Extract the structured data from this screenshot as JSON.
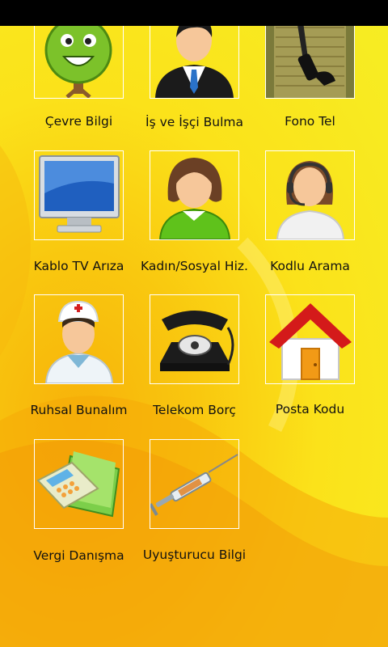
{
  "tiles": [
    {
      "label": "Çevre Bilgi",
      "icon": "tree-smiley-icon"
    },
    {
      "label": "İş ve İşçi Bulma",
      "icon": "businessman-icon"
    },
    {
      "label": "Fono Tel",
      "icon": "phone-handset-icon"
    },
    {
      "label": "Kablo TV Arıza",
      "icon": "tv-monitor-icon"
    },
    {
      "label": "Kadın/Sosyal Hiz.",
      "icon": "woman-avatar-icon"
    },
    {
      "label": "Kodlu Arama",
      "icon": "operator-headset-icon"
    },
    {
      "label": "Ruhsal Bunalım",
      "icon": "nurse-icon"
    },
    {
      "label": "Telekom Borç",
      "icon": "rotary-phone-icon"
    },
    {
      "label": "Posta Kodu",
      "icon": "house-icon"
    },
    {
      "label": "Vergi Danışma",
      "icon": "calculator-folder-icon"
    },
    {
      "label": "Uyuşturucu Bilgi",
      "icon": "syringe-icon"
    }
  ],
  "colors": {
    "background": "#f9d21a",
    "tile_border": "#ffffff",
    "label_text": "#111111",
    "status_bar": "#000000"
  }
}
